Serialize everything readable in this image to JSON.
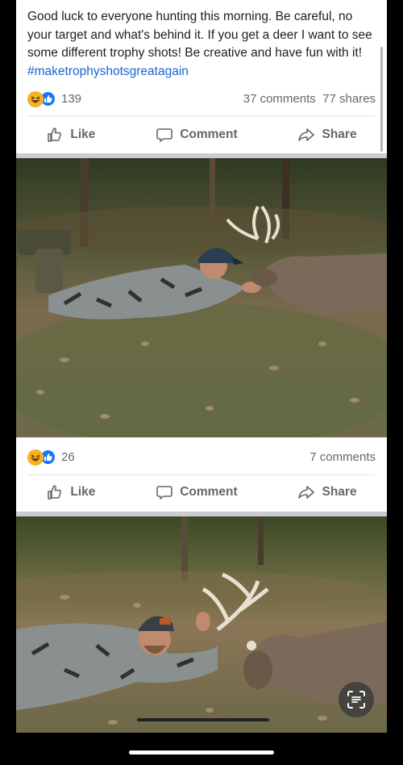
{
  "post1": {
    "text": "Good luck to everyone hunting this morning. Be careful, no your target and what's behind it. If you get a deer I want to see some different trophy shots! Be creative and have fun with it!",
    "hashtag": "#maketrophyshotsgreatagain",
    "reaction_count": "139",
    "comments": "37 comments",
    "shares": "77 shares"
  },
  "post2": {
    "reaction_count": "26",
    "comments": "7 comments"
  },
  "actions": {
    "like": "Like",
    "comment": "Comment",
    "share": "Share"
  },
  "colors": {
    "link": "#1a64d4",
    "like_blue": "#1877f2",
    "haha_yellow": "#f7b125",
    "meta_gray": "#65676b"
  },
  "icons": [
    "haha-reaction-icon",
    "like-reaction-icon",
    "thumbs-up-icon",
    "comment-icon",
    "share-icon",
    "scan-text-icon"
  ]
}
